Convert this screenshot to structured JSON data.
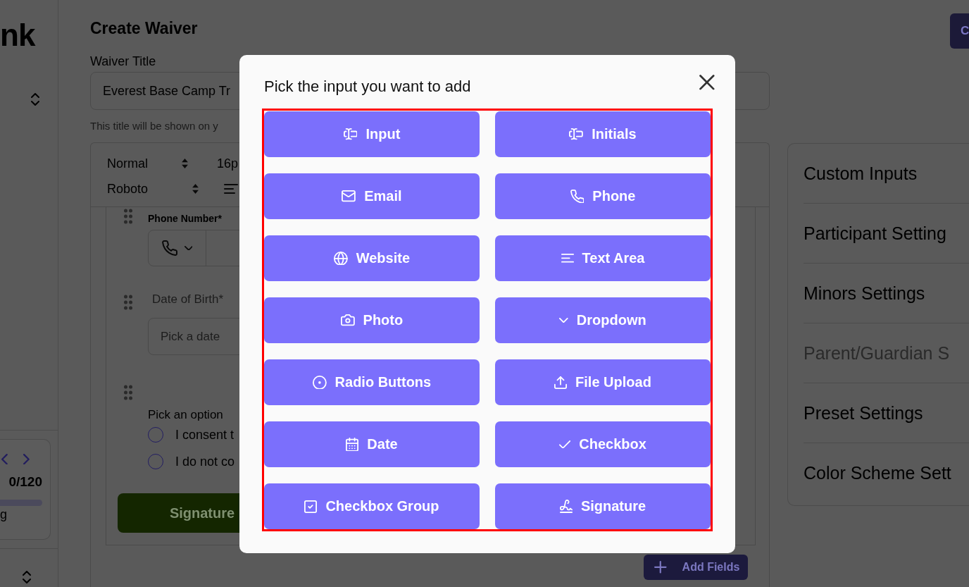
{
  "sidebar": {
    "logo": "nk",
    "progress_card": {
      "counter": "0/120",
      "caption": "g"
    }
  },
  "header": {
    "title": "Create Waiver",
    "action_button": "C"
  },
  "waiver_title": {
    "label": "Waiver Title",
    "value": "Everest Base Camp Tr",
    "hint": "This title will be shown on y"
  },
  "editor": {
    "toolbar": {
      "block_style": "Normal",
      "font_size": "16p",
      "font_family": "Roboto"
    },
    "fields": [
      {
        "kind": "phone",
        "label": "Phone Number*"
      },
      {
        "kind": "date",
        "label": "Date of Birth*",
        "placeholder": "Pick a date"
      },
      {
        "kind": "radio",
        "label": "Pick an option",
        "options": [
          {
            "label": "I consent t",
            "selected": false
          },
          {
            "label": "I do not co",
            "selected": false
          }
        ]
      },
      {
        "kind": "button",
        "label": "Signature"
      }
    ],
    "add_button": "Add Fields"
  },
  "settings": {
    "items": [
      {
        "label": "Custom Inputs",
        "disabled": false
      },
      {
        "label": "Participant Setting",
        "disabled": false
      },
      {
        "label": "Minors Settings",
        "disabled": false
      },
      {
        "label": "Parent/Guardian S",
        "disabled": true
      },
      {
        "label": "Preset Settings",
        "disabled": false
      },
      {
        "label": "Color Scheme Sett",
        "disabled": false
      }
    ]
  },
  "modal": {
    "title": "Pick the input you want to add",
    "options": [
      {
        "kind": "text",
        "label": "Input"
      },
      {
        "kind": "initials",
        "label": "Initials"
      },
      {
        "kind": "email",
        "label": "Email"
      },
      {
        "kind": "phone",
        "label": "Phone"
      },
      {
        "kind": "website",
        "label": "Website"
      },
      {
        "kind": "textarea",
        "label": "Text Area"
      },
      {
        "kind": "photo",
        "label": "Photo"
      },
      {
        "kind": "dropdown",
        "label": "Dropdown"
      },
      {
        "kind": "radio",
        "label": "Radio Buttons"
      },
      {
        "kind": "upload",
        "label": "File Upload"
      },
      {
        "kind": "date",
        "label": "Date"
      },
      {
        "kind": "checkbox",
        "label": "Checkbox"
      },
      {
        "kind": "checkbox_group",
        "label": "Checkbox Group"
      },
      {
        "kind": "signature",
        "label": "Signature"
      }
    ]
  }
}
